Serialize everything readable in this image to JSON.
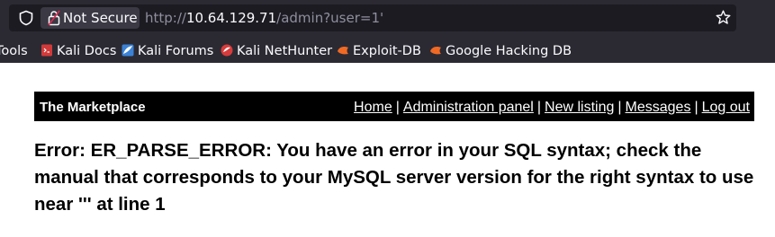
{
  "browser": {
    "security_label": "Not Secure",
    "url_prefix": "http://",
    "url_host": "10.64.129.71",
    "url_path": "/admin?user=1'"
  },
  "bookmarks": [
    {
      "label": "Tools",
      "icon": "none"
    },
    {
      "label": "Kali Docs",
      "icon": "kali-docs-icon"
    },
    {
      "label": "Kali Forums",
      "icon": "kali-forums-icon"
    },
    {
      "label": "Kali NetHunter",
      "icon": "nethunter-icon"
    },
    {
      "label": "Exploit-DB",
      "icon": "exploit-db-icon"
    },
    {
      "label": "Google Hacking DB",
      "icon": "ghdb-icon"
    }
  ],
  "site": {
    "brand": "The Marketplace",
    "nav": [
      "Home",
      "Administration panel",
      "New listing",
      "Messages",
      "Log out"
    ],
    "nav_separator": "|"
  },
  "error_message": "Error: ER_PARSE_ERROR: You have an error in your SQL syntax; check the manual that corresponds to your MySQL server version for the right syntax to use near ''' at line 1",
  "colors": {
    "chrome_bg": "#2b2a33",
    "urlbar_bg": "#1c1b22",
    "navbar_bg": "#000000"
  }
}
